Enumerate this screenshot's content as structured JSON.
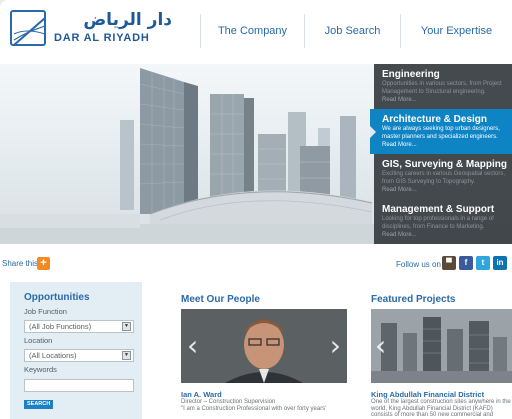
{
  "brand": {
    "name_arabic": "دار الرياض",
    "name_latin": "DAR AL RIYADH"
  },
  "nav": [
    {
      "label": "The Company"
    },
    {
      "label": "Job Search"
    },
    {
      "label": "Your Expertise"
    }
  ],
  "hero_panels": [
    {
      "title": "Engineering",
      "description_line1": "Opportunities in various sectors, from Project",
      "description_line2": "Management to Structural engineering.",
      "more": "Read More..."
    },
    {
      "title": "Architecture & Design",
      "description_line1": "We are always seeking top urban designers,",
      "description_line2": "master planners and specialized engineers.",
      "more": "Read More..."
    },
    {
      "title": "GIS, Surveying & Mapping",
      "description_line1": "Exciting careers in various Geospatial sectors,",
      "description_line2": "from GIS Surveying to Topography.",
      "more": "Read More..."
    },
    {
      "title": "Management & Support",
      "description_line1": "Looking for top professionals in a range of",
      "description_line2": "disciplines, from Finance to Marketing.",
      "more": "Read More..."
    }
  ],
  "share": {
    "label": "Share this",
    "button": "+"
  },
  "follow": {
    "label": "Follow us on",
    "networks": [
      {
        "name": "blog",
        "icon": "blog-icon",
        "glyph": "▀"
      },
      {
        "name": "facebook",
        "icon": "facebook-icon",
        "glyph": "f"
      },
      {
        "name": "twitter",
        "icon": "twitter-icon",
        "glyph": "t"
      },
      {
        "name": "linkedin",
        "icon": "linkedin-icon",
        "glyph": "in"
      }
    ]
  },
  "opportunities": {
    "title": "Opportunities",
    "job_function_label": "Job Function",
    "job_function_value": "(All Job Functions)",
    "location_label": "Location",
    "location_value": "(All Locations)",
    "keywords_label": "Keywords",
    "keywords_value": "",
    "search_button": "SEARCH"
  },
  "people": {
    "title": "Meet Our People",
    "prev": "‹",
    "next": "›",
    "name": "Ian A. Ward",
    "role": "Director – Construction Supervision",
    "quote": "\"I am a Construction Professional with over forty years'"
  },
  "projects": {
    "title": "Featured Projects",
    "prev": "‹",
    "name": "King Abdullah Financial District",
    "description": "One of the largest construction sites anywhere in the world, King Abdullah Financial District (KAFD) consists of more than 50 new commercial and"
  },
  "colors": {
    "brand_blue": "#2a6aa8",
    "active_panel": "#0f84c5",
    "share_orange": "#f28a22",
    "facebook": "#3b5a9a",
    "twitter": "#2fa6dc",
    "linkedin": "#0b73b1"
  }
}
